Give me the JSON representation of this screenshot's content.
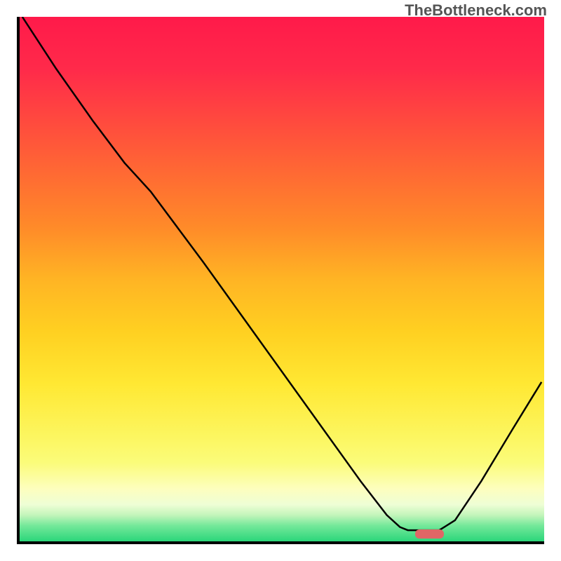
{
  "watermark": "TheBottleneck.com",
  "chart_data": {
    "type": "line",
    "title": "",
    "xlabel": "",
    "ylabel": "",
    "xlim": [
      0,
      100
    ],
    "ylim": [
      0,
      100
    ],
    "points": [
      {
        "x": 0.5,
        "y": 100
      },
      {
        "x": 7,
        "y": 90
      },
      {
        "x": 14,
        "y": 80
      },
      {
        "x": 20,
        "y": 72
      },
      {
        "x": 25,
        "y": 66.5
      },
      {
        "x": 35,
        "y": 53
      },
      {
        "x": 45,
        "y": 39
      },
      {
        "x": 55,
        "y": 25
      },
      {
        "x": 65,
        "y": 11
      },
      {
        "x": 70,
        "y": 4.5
      },
      {
        "x": 72.5,
        "y": 2.2
      },
      {
        "x": 74,
        "y": 1.6
      },
      {
        "x": 80,
        "y": 1.6
      },
      {
        "x": 83,
        "y": 3.5
      },
      {
        "x": 88,
        "y": 11
      },
      {
        "x": 94,
        "y": 21
      },
      {
        "x": 99.5,
        "y": 30
      }
    ],
    "marker": {
      "x": 75,
      "width": 5.5,
      "height": 1.8,
      "color": "#e06666"
    },
    "gradient_stops": [
      {
        "pct": 0,
        "color": "#ff1a4a"
      },
      {
        "pct": 50,
        "color": "#ffd021"
      },
      {
        "pct": 85,
        "color": "#fbfc7a"
      },
      {
        "pct": 100,
        "color": "#2bd67a"
      }
    ]
  },
  "colors": {
    "axis": "#000000",
    "curve": "#000000",
    "marker": "#e06666"
  }
}
